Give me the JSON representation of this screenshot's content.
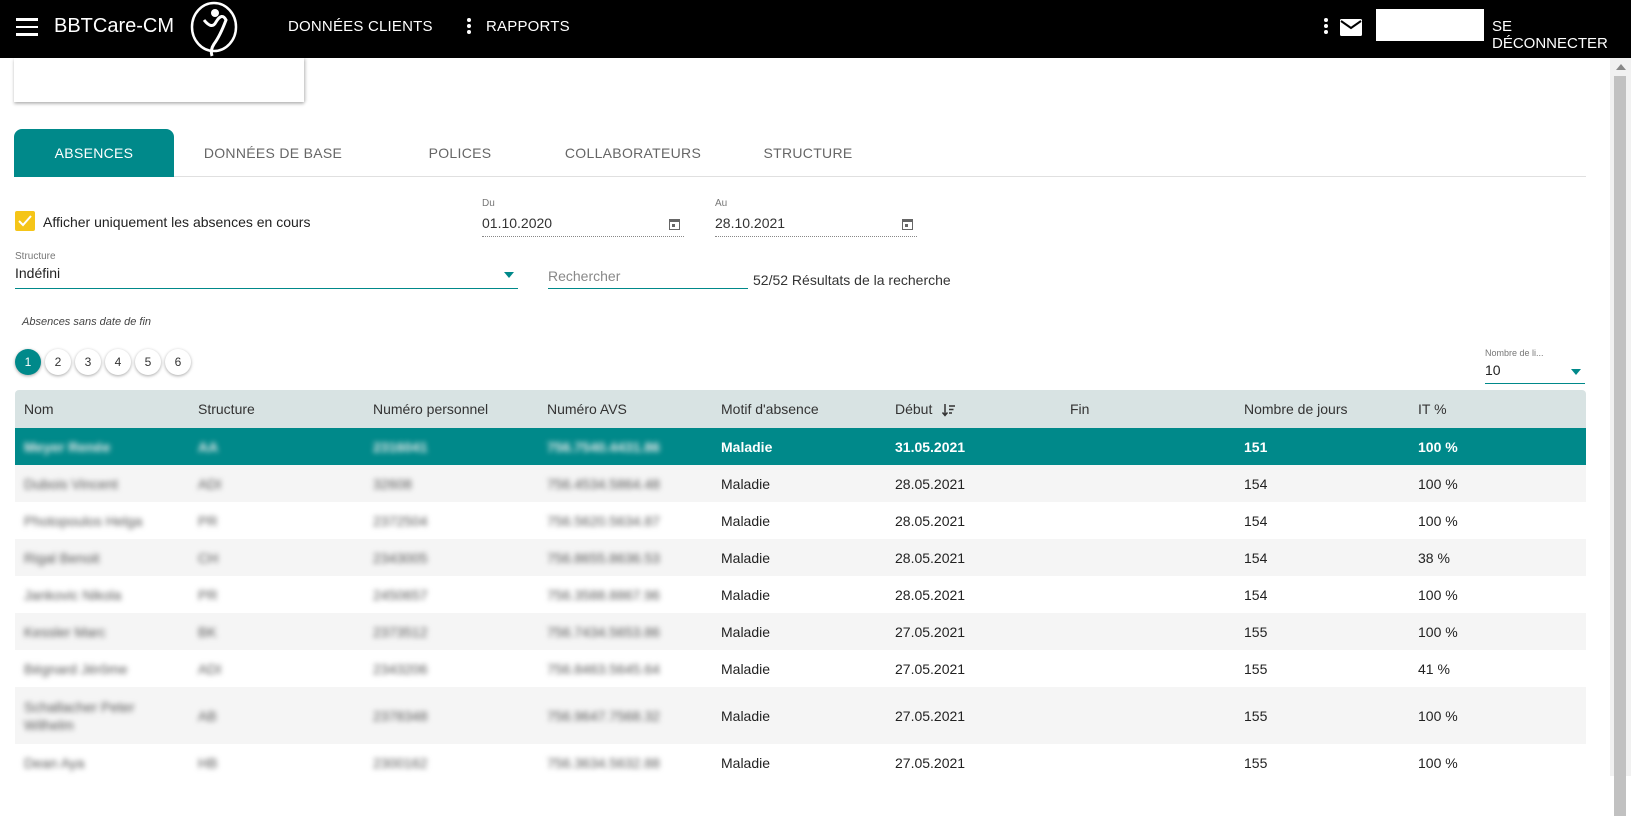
{
  "header": {
    "app_title": "BBTCare-CM",
    "nav": [
      "DONNÉES CLIENTS",
      "RAPPORTS"
    ],
    "logout": "SE DÉCONNECTER",
    "user_name": ""
  },
  "tabs": [
    "ABSENCES",
    "DONNÉES DE BASE",
    "POLICES",
    "COLLABORATEURS",
    "STRUCTURE"
  ],
  "filters": {
    "checkbox_label": "Afficher uniquement les absences en cours",
    "checkbox_checked": true,
    "from_label": "Du",
    "from_value": "01.10.2020",
    "to_label": "Au",
    "to_value": "28.10.2021",
    "structure_label": "Structure",
    "structure_value": "Indéfini",
    "search_placeholder": "Rechercher",
    "results_text": "52/52 Résultats de la recherche"
  },
  "section_note": "Absences sans date de fin",
  "pagination": {
    "pages": [
      "1",
      "2",
      "3",
      "4",
      "5",
      "6"
    ],
    "active": 1,
    "rows_label": "Nombre de li...",
    "rows_value": "10"
  },
  "table": {
    "columns": [
      "Nom",
      "Structure",
      "Numéro personnel",
      "Numéro AVS",
      "Motif d'absence",
      "Début",
      "Fin",
      "Nombre de jours",
      "IT %"
    ],
    "sort_column": "Début",
    "rows": [
      {
        "nom": "Meyer Renée",
        "structure": "AA",
        "numero": "2316041",
        "avs": "756.7540.4431.86",
        "motif": "Maladie",
        "debut": "31.05.2021",
        "fin": "",
        "jours": "151",
        "it": "100 %"
      },
      {
        "nom": "Dubois Vincent",
        "structure": "ADI",
        "numero": "32608",
        "avs": "756.4534.5864.48",
        "motif": "Maladie",
        "debut": "28.05.2021",
        "fin": "",
        "jours": "154",
        "it": "100 %"
      },
      {
        "nom": "Photopoulos Helga",
        "structure": "PR",
        "numero": "2372504",
        "avs": "756.5620.5634.87",
        "motif": "Maladie",
        "debut": "28.05.2021",
        "fin": "",
        "jours": "154",
        "it": "100 %"
      },
      {
        "nom": "Rigal Benoit",
        "structure": "CH",
        "numero": "2343005",
        "avs": "756.8655.8636.53",
        "motif": "Maladie",
        "debut": "28.05.2021",
        "fin": "",
        "jours": "154",
        "it": "38 %"
      },
      {
        "nom": "Jankovic Nikola",
        "structure": "PR",
        "numero": "2450657",
        "avs": "756.3588.8867.96",
        "motif": "Maladie",
        "debut": "28.05.2021",
        "fin": "",
        "jours": "154",
        "it": "100 %"
      },
      {
        "nom": "Kessler Marc",
        "structure": "BK",
        "numero": "2373512",
        "avs": "756.7434.5653.86",
        "motif": "Maladie",
        "debut": "27.05.2021",
        "fin": "",
        "jours": "155",
        "it": "100 %"
      },
      {
        "nom": "Bégnard Jérôme",
        "structure": "ADI",
        "numero": "2343206",
        "avs": "756.8463.5645.64",
        "motif": "Maladie",
        "debut": "27.05.2021",
        "fin": "",
        "jours": "155",
        "it": "41 %"
      },
      {
        "nom": "Schallacher Peter Wilhelm",
        "structure": "AB",
        "numero": "2378348",
        "avs": "756.9647.7568.32",
        "motif": "Maladie",
        "debut": "27.05.2021",
        "fin": "",
        "jours": "155",
        "it": "100 %"
      },
      {
        "nom": "Dean Aya",
        "structure": "HB",
        "numero": "2300162",
        "avs": "756.3634.5632.88",
        "motif": "Maladie",
        "debut": "27.05.2021",
        "fin": "",
        "jours": "155",
        "it": "100 %"
      }
    ]
  },
  "colors": {
    "topbar": "#000000",
    "accent": "#00898a",
    "checkbox": "#f5c518",
    "table_header": "#d8e3e3",
    "row_alt": "#f5f5f5"
  },
  "icons": [
    "menu-icon",
    "brand-logo-icon",
    "more-vert-icon",
    "mail-icon",
    "calendar-icon",
    "dropdown-caret-icon",
    "sort-descending-icon",
    "check-icon"
  ]
}
